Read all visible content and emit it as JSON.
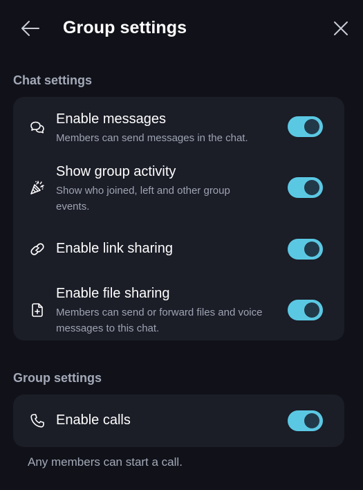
{
  "header": {
    "title": "Group settings",
    "back_icon": "arrow-left-icon",
    "close_icon": "close-icon"
  },
  "chat_settings": {
    "title": "Chat settings",
    "items": [
      {
        "title": "Enable messages",
        "description": "Members can send messages in the chat.",
        "icon": "chat-bubbles-icon",
        "enabled": true
      },
      {
        "title": "Show group activity",
        "description": "Show who joined, left and other group events.",
        "icon": "party-popper-icon",
        "enabled": true
      },
      {
        "title": "Enable link sharing",
        "description": "",
        "icon": "link-icon",
        "enabled": true
      },
      {
        "title": "Enable file sharing",
        "description": "Members can send or forward files and voice messages to this chat.",
        "icon": "file-add-icon",
        "enabled": true
      }
    ]
  },
  "group_settings": {
    "title": "Group settings",
    "items": [
      {
        "title": "Enable calls",
        "icon": "phone-icon",
        "enabled": true
      }
    ],
    "footnote": "Any members can start a call."
  },
  "colors": {
    "background": "#111219",
    "card": "#1b1d27",
    "toggle_on": "#5bc8e3",
    "toggle_knob": "#22394a",
    "secondary_text": "#9ea4b3"
  }
}
